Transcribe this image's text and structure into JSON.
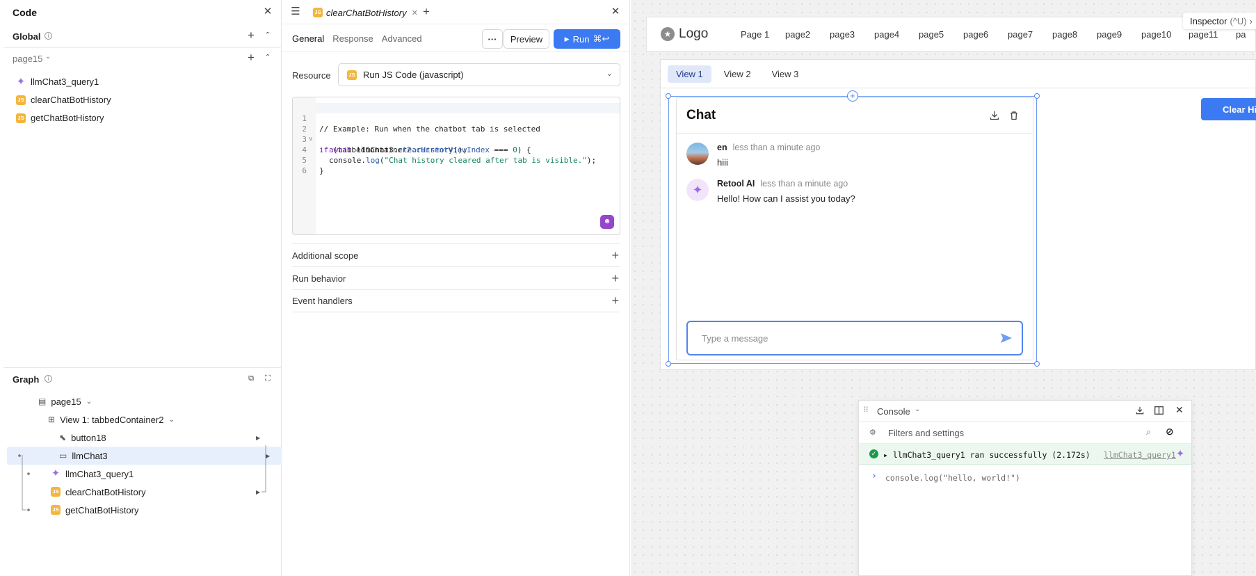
{
  "code_panel": {
    "title": "Code",
    "global_label": "Global",
    "page_label": "page15",
    "queries": [
      {
        "name": "llmChat3_query1",
        "icon": "sparkle-icon"
      },
      {
        "name": "clearChatBotHistory",
        "icon": "js-icon"
      },
      {
        "name": "getChatBotHistory",
        "icon": "js-icon"
      }
    ],
    "js_badge": "JS"
  },
  "graph": {
    "title": "Graph",
    "nodes": [
      {
        "label": "page15",
        "icon": "page-icon"
      },
      {
        "label": "View 1: tabbedContainer2",
        "icon": "container-icon"
      },
      {
        "label": "button18",
        "icon": "cursor-click-icon"
      },
      {
        "label": "llmChat3",
        "icon": "chat-bubble-icon"
      },
      {
        "label": "llmChat3_query1",
        "icon": "sparkle-icon"
      },
      {
        "label": "clearChatBotHistory",
        "icon": "js-icon"
      },
      {
        "label": "getChatBotHistory",
        "icon": "js-icon"
      }
    ]
  },
  "editor": {
    "tab_name": "clearChatBotHistory",
    "subtabs": [
      "General",
      "Response",
      "Advanced"
    ],
    "more_label": "···",
    "preview_label": "Preview",
    "run_label": "Run",
    "run_shortcut": "⌘↩",
    "resource_label": "Resource",
    "resource_value": "Run JS Code (javascript)",
    "line_numbers": [
      "1",
      "2",
      "3",
      "4",
      "5",
      "6"
    ],
    "accordions": [
      "Additional scope",
      "Run behavior",
      "Event handlers"
    ]
  },
  "code_lines": {
    "l1": "// Example: Run when the chatbot tab is selected",
    "l2_a": "if",
    "l2_b": " (tabbedContainer2.",
    "l2_c": "currentViewIndex",
    "l2_d": " === ",
    "l2_e": "0",
    "l2_f": ") {",
    "l3_a": "await",
    "l3_b": " llmChat3.",
    "l3_c": "clearHistory",
    "l3_d": "();",
    "l4_a": "console.",
    "l4_b": "log",
    "l4_c": "(",
    "l4_d": "\"Chat history cleared after tab is visible.\"",
    "l4_e": ");",
    "l5": "}"
  },
  "canvas": {
    "logo_text": "Logo",
    "nav": [
      "Page 1",
      "page2",
      "page3",
      "page4",
      "page5",
      "page6",
      "page7",
      "page8",
      "page9",
      "page10",
      "page11",
      "pa"
    ],
    "inspector_label": "Inspector",
    "inspector_shortcut": "(^U)",
    "view_tabs": [
      "View 1",
      "View 2",
      "View 3"
    ],
    "chat": {
      "title": "Chat",
      "messages": [
        {
          "author": "en",
          "time": "less than a minute ago",
          "text": "hiii"
        },
        {
          "author": "Retool AI",
          "time": "less than a minute ago",
          "text": "Hello! How can I assist you today?"
        }
      ],
      "input_placeholder": "Type a message"
    },
    "clear_button": "Clear His"
  },
  "console": {
    "title": "Console",
    "filter_placeholder": "Filters and settings",
    "success_text": "▸ llmChat3_query1 ran successfully (2.172s)",
    "success_link": "llmChat3_query1",
    "input_text": "console.log(\"hello, world!\")",
    "prompt": "›"
  },
  "colors": {
    "accent": "#3b7af2",
    "js_badge": "#f4b63f",
    "sparkle": "#9b6ee3",
    "selection": "#e6effb",
    "success_bg": "#ecf8ef"
  }
}
